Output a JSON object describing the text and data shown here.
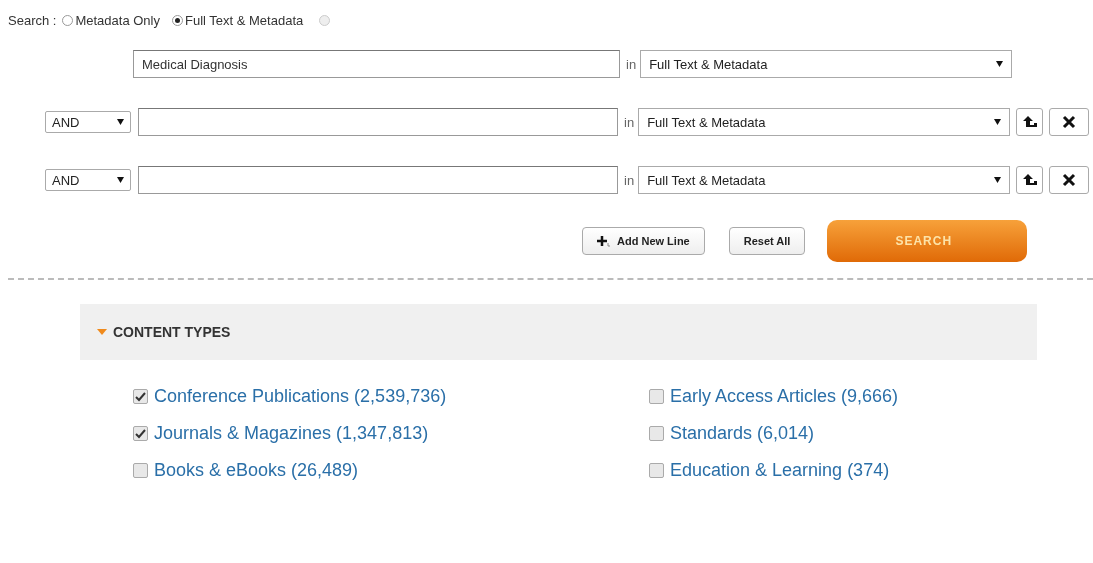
{
  "search_scope": {
    "label": "Search :",
    "options": [
      {
        "label": "Metadata Only",
        "selected": false
      },
      {
        "label": "Full Text & Metadata",
        "selected": true
      }
    ]
  },
  "query_rows": [
    {
      "kind": "first",
      "value": "Medical Diagnosis",
      "in_label": "in",
      "field": "Full Text & Metadata"
    },
    {
      "kind": "extra",
      "operator": "AND",
      "value": "",
      "in_label": "in",
      "field": "Full Text & Metadata"
    },
    {
      "kind": "extra",
      "operator": "AND",
      "value": "",
      "in_label": "in",
      "field": "Full Text & Metadata"
    }
  ],
  "actions": {
    "add_line": "Add New Line",
    "reset": "Reset All",
    "search": "SEARCH"
  },
  "content_types": {
    "title": "CONTENT TYPES",
    "expanded": true,
    "columns": [
      [
        {
          "label": "Conference Publications (2,539,736)",
          "checked": true
        },
        {
          "label": "Journals & Magazines (1,347,813)",
          "checked": true
        },
        {
          "label": "Books & eBooks (26,489)",
          "checked": false
        }
      ],
      [
        {
          "label": "Early Access Articles (9,666)",
          "checked": false
        },
        {
          "label": "Standards (6,014)",
          "checked": false
        },
        {
          "label": "Education & Learning (374)",
          "checked": false
        }
      ]
    ]
  }
}
